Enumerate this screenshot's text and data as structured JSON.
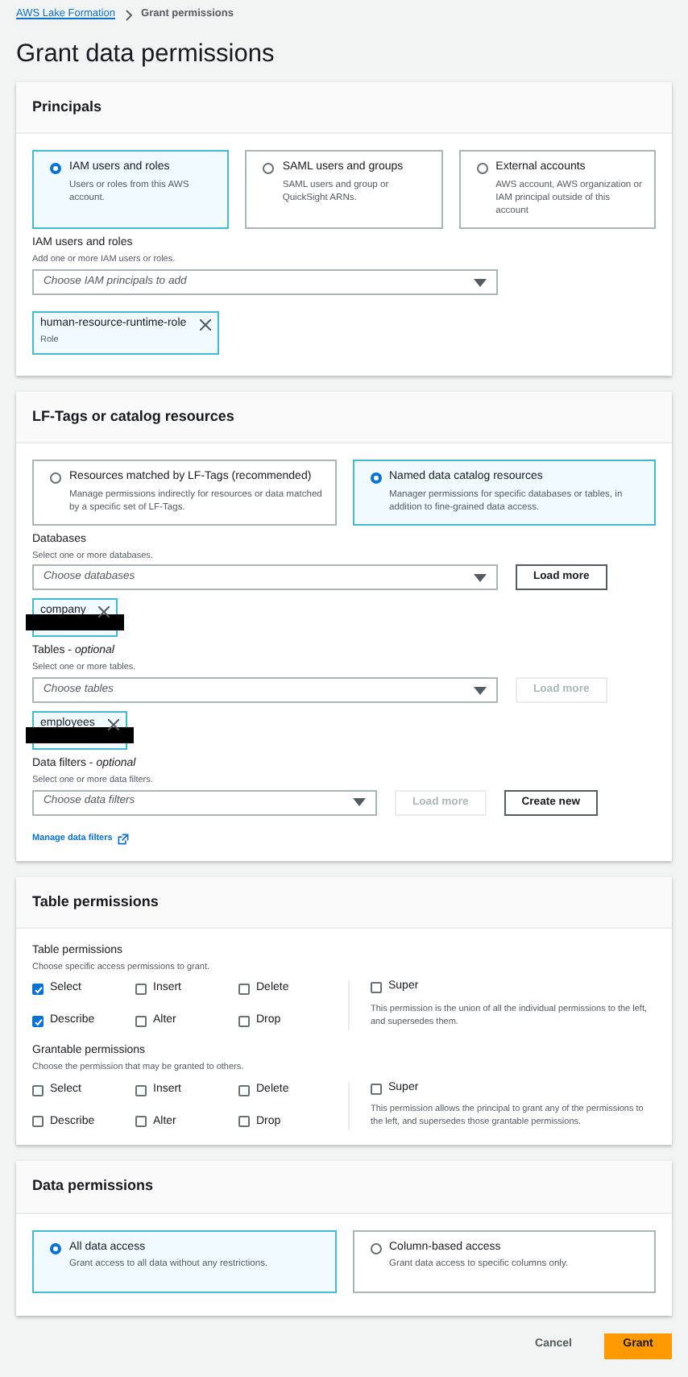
{
  "breadcrumb": [
    {
      "label": "AWS Lake Formation",
      "kind": "link"
    },
    {
      "label": "Grant permissions",
      "kind": "current"
    }
  ],
  "title": "Grant data permissions",
  "principals": {
    "heading": "Principals",
    "options": [
      {
        "label": "IAM users and roles",
        "description": "Users or roles from this AWS account.",
        "selected": true
      },
      {
        "label": "SAML users and groups",
        "description": "SAML users and group or QuickSight ARNs.",
        "selected": false
      },
      {
        "label": "External accounts",
        "description": "AWS account, AWS organization or IAM principal outside of this account",
        "selected": false
      }
    ],
    "fields": [
      {
        "label": "IAM users and roles",
        "hint": "Add one or more IAM users or roles.",
        "placeholder": "Choose IAM principals to add",
        "tokens": [
          {
            "label": "human-resource-runtime-role",
            "sublabel": "Role",
            "redacted": false
          }
        ]
      }
    ]
  },
  "resources": {
    "heading": "LF-Tags or catalog resources",
    "options": [
      {
        "label": "Resources matched by LF-Tags (recommended)",
        "description": "Manage permissions indirectly for resources or data matched by a specific set of LF-Tags.",
        "selected": false
      },
      {
        "label": "Named data catalog resources",
        "description": "Manager permissions for specific databases or tables, in addition to fine-grained data access.",
        "selected": true
      }
    ],
    "fields": [
      {
        "label": "Databases",
        "hint": "Select one or more databases.",
        "placeholder": "Choose databases",
        "buttons": [
          {
            "label": "Load more",
            "disabled": false
          }
        ],
        "tokens": [
          {
            "label": "company",
            "redacted": true
          }
        ]
      },
      {
        "label": "Tables - *optional*",
        "hint": "Select one or more tables.",
        "placeholder": "Choose tables",
        "buttons": [
          {
            "label": "Load more",
            "disabled": true
          }
        ],
        "tokens": [
          {
            "label": "employees",
            "redacted": true
          }
        ]
      },
      {
        "label": "Data filters - *optional*",
        "hint": "Select one or more data filters.",
        "placeholder": "Choose data filters",
        "buttons": [
          {
            "label": "Load more",
            "disabled": true
          },
          {
            "label": "Create new",
            "disabled": false
          }
        ]
      }
    ],
    "link": "Manage data filters"
  },
  "table_permissions": {
    "heading": "Table permissions",
    "groups": [
      {
        "label": "Table permissions",
        "hint": "Choose specific access permissions to grant.",
        "items": [
          {
            "label": "Select",
            "checked": true
          },
          {
            "label": "Insert",
            "checked": false
          },
          {
            "label": "Delete",
            "checked": false
          },
          {
            "label": "Describe",
            "checked": true
          },
          {
            "label": "Alter",
            "checked": false
          },
          {
            "label": "Drop",
            "checked": false
          }
        ],
        "super": {
          "label": "Super",
          "checked": false,
          "description": "This permission is the union of all the individual permissions to the left, and supersedes them."
        }
      },
      {
        "label": "Grantable permissions",
        "hint": "Choose the permission that may be granted to others.",
        "items": [
          {
            "label": "Select",
            "checked": false
          },
          {
            "label": "Insert",
            "checked": false
          },
          {
            "label": "Delete",
            "checked": false
          },
          {
            "label": "Describe",
            "checked": false
          },
          {
            "label": "Alter",
            "checked": false
          },
          {
            "label": "Drop",
            "checked": false
          }
        ],
        "super": {
          "label": "Super",
          "checked": false,
          "description": "This permission allows the principal to grant any of the permissions to the left, and supersedes those grantable permissions."
        }
      }
    ]
  },
  "data_permissions": {
    "heading": "Data permissions",
    "options": [
      {
        "label": "All data access",
        "description": "Grant access to all data without any restrictions.",
        "selected": true
      },
      {
        "label": "Column-based access",
        "description": "Grant data access to specific columns only.",
        "selected": false
      }
    ]
  },
  "footer": [
    {
      "label": "Cancel",
      "kind": "link"
    },
    {
      "label": "Grant",
      "kind": "primary"
    }
  ]
}
